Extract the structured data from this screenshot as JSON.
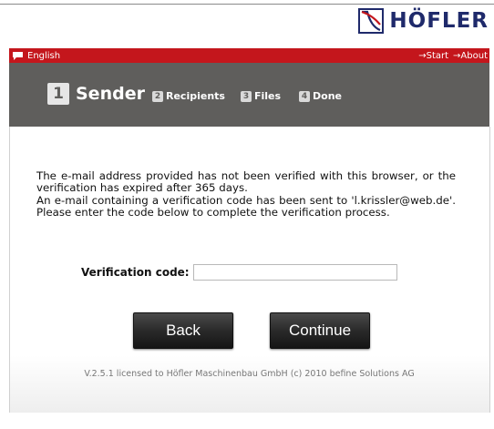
{
  "brand": {
    "name": "HÖFLER",
    "colors": {
      "logo": "#1f2a6b",
      "bar": "#c4161c",
      "steps": "#5f5e5c"
    }
  },
  "topbar": {
    "language": "English",
    "links": [
      "→Start",
      "→About"
    ]
  },
  "steps": [
    {
      "num": "1",
      "label": "Sender",
      "active": true
    },
    {
      "num": "2",
      "label": "Recipients",
      "active": false
    },
    {
      "num": "3",
      "label": "Files",
      "active": false
    },
    {
      "num": "4",
      "label": "Done",
      "active": false
    }
  ],
  "message": {
    "line1": "The e-mail address provided has not been verified with this browser, or the verification has expired after 365 days.",
    "line2": "An e-mail containing a verification code has been sent to 'l.krissler@web.de'. Please enter the code below to complete the verification process."
  },
  "form": {
    "code_label": "Verification code:",
    "code_value": ""
  },
  "buttons": {
    "back": "Back",
    "continue": "Continue"
  },
  "footer": {
    "text": "V.2.5.1 licensed to Höfler Maschinenbau GmbH (c) 2010 befine Solutions AG"
  }
}
